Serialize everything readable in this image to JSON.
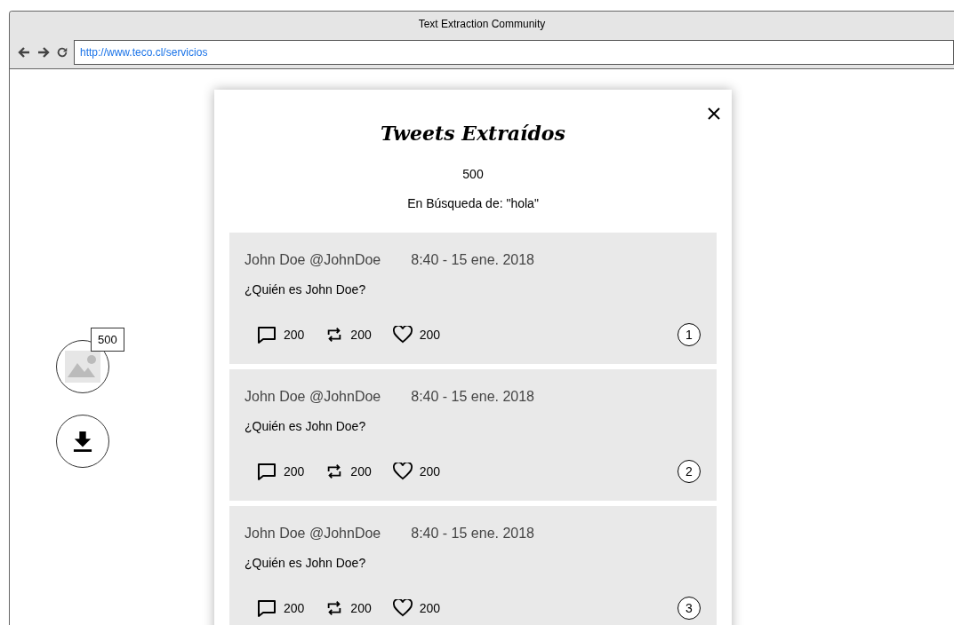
{
  "window": {
    "title": "Text Extraction Community"
  },
  "address_bar": {
    "url": "http://www.teco.cl/servicios"
  },
  "side_buttons": {
    "image_badge": "500"
  },
  "dialog": {
    "title": "Tweets Extraídos",
    "count": "500",
    "query": "En Búsqueda de: \"hola\""
  },
  "tweets": [
    {
      "author": "John Doe @JohnDoe",
      "time": "8:40 - 15 ene. 2018",
      "text": "¿Quién es John Doe?",
      "replies": "200",
      "retweets": "200",
      "likes": "200",
      "number": "1"
    },
    {
      "author": "John Doe @JohnDoe",
      "time": "8:40 - 15 ene. 2018",
      "text": "¿Quién es John Doe?",
      "replies": "200",
      "retweets": "200",
      "likes": "200",
      "number": "2"
    },
    {
      "author": "John Doe @JohnDoe",
      "time": "8:40 - 15 ene. 2018",
      "text": "¿Quién es John Doe?",
      "replies": "200",
      "retweets": "200",
      "likes": "200",
      "number": "3"
    }
  ]
}
